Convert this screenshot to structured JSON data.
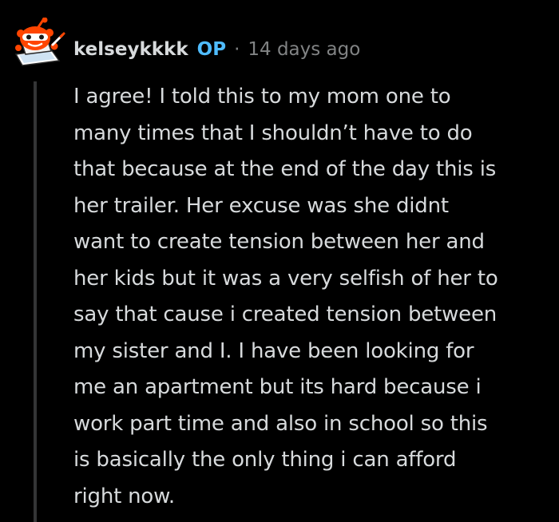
{
  "comment": {
    "author": "kelseykkkk",
    "op_badge": "OP",
    "separator": "·",
    "timestamp": "14 days ago",
    "avatar_icon": "snoo-avatar-icon",
    "body_lines": [
      "I agree! I told this to my mom one to",
      "many times that I shouldn’t have to do",
      "that because at the end of the day this is",
      "her trailer. Her excuse was she didnt",
      "want to create tension between her and",
      "her kids but it was a very selfish of her to",
      "say that cause i created tension between",
      "my sister and I. I have been looking for",
      "me an apartment but its hard because i",
      "work part time and also in school so this",
      "is basically the only thing i can afford",
      "right now."
    ]
  },
  "colors": {
    "background": "#000000",
    "text": "#d7dadc",
    "op_badge": "#4fbcff",
    "meta": "#818384",
    "thread_line": "#343536"
  }
}
